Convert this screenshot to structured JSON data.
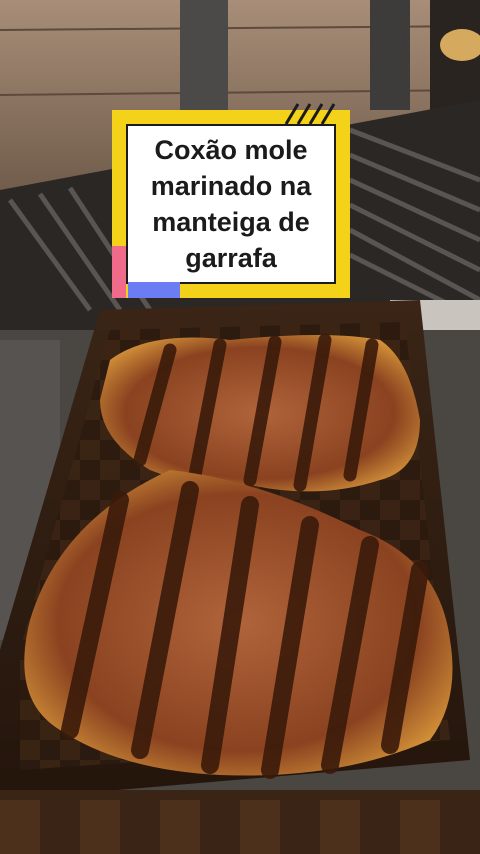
{
  "caption": {
    "text": "Coxão mole\nmarinado na\nmanteiga de\ngarrafa"
  },
  "colors": {
    "caption_frame": "#f5d21a",
    "caption_accent_pink": "#f06b8a",
    "caption_accent_blue": "#6c7df3"
  }
}
